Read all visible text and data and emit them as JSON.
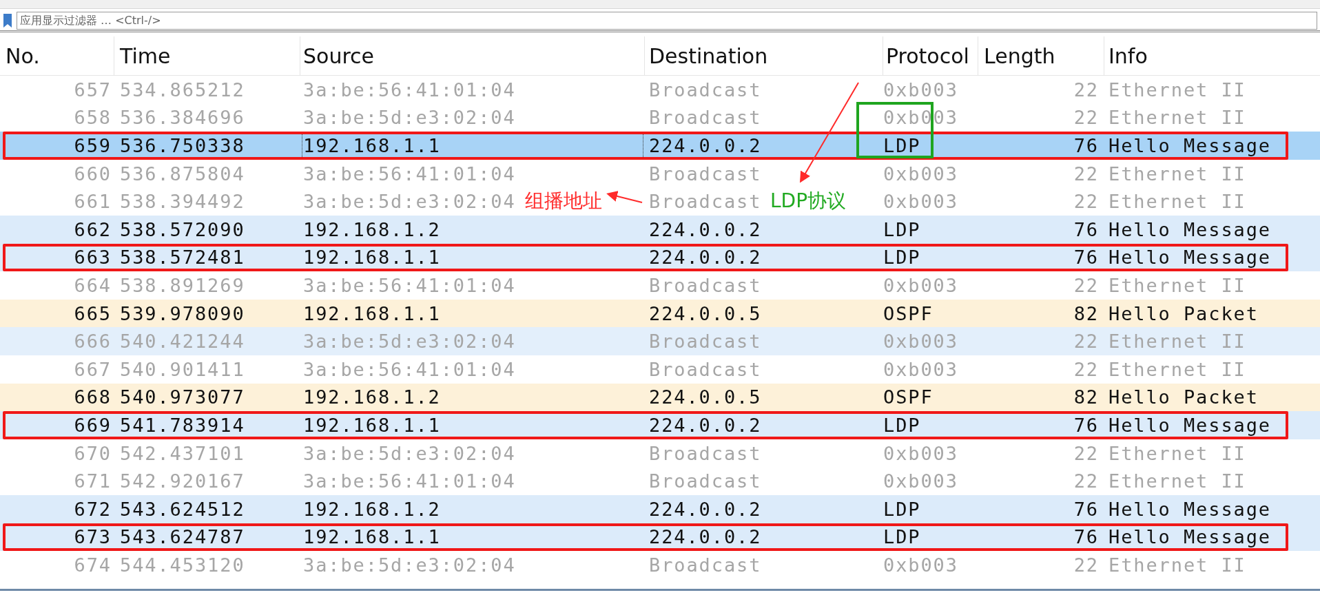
{
  "filter_bar": {
    "placeholder": "应用显示过滤器 … <Ctrl-/>"
  },
  "table": {
    "columns": [
      "No.",
      "Time",
      "Source",
      "Destination",
      "Protocol",
      "Length",
      "Info"
    ],
    "rows": [
      {
        "cells": [
          "657",
          "534.865212",
          "3a:be:56:41:01:04",
          "Broadcast",
          "0xb003",
          "22",
          "Ethernet II"
        ],
        "kind": "other",
        "selected": false,
        "boxed": false
      },
      {
        "cells": [
          "658",
          "536.384696",
          "3a:be:5d:e3:02:04",
          "Broadcast",
          "0xb003",
          "22",
          "Ethernet II"
        ],
        "kind": "other",
        "selected": false,
        "boxed": false
      },
      {
        "cells": [
          "659",
          "536.750338",
          "192.168.1.1",
          "224.0.0.2",
          "LDP",
          "76",
          "Hello Message"
        ],
        "kind": "ldp",
        "selected": true,
        "boxed": true
      },
      {
        "cells": [
          "660",
          "536.875804",
          "3a:be:56:41:01:04",
          "Broadcast",
          "0xb003",
          "22",
          "Ethernet II"
        ],
        "kind": "other",
        "selected": false,
        "boxed": false
      },
      {
        "cells": [
          "661",
          "538.394492",
          "3a:be:5d:e3:02:04",
          "Broadcast",
          "0xb003",
          "22",
          "Ethernet II"
        ],
        "kind": "other",
        "selected": false,
        "boxed": false,
        "annotations": [
          {
            "kind": "label",
            "text": "组播地址",
            "color": "#ff2a2a"
          },
          {
            "kind": "label",
            "text": "LDP协议",
            "color": "#22aa22"
          }
        ]
      },
      {
        "cells": [
          "662",
          "538.572090",
          "192.168.1.2",
          "224.0.0.2",
          "LDP",
          "76",
          "Hello Message"
        ],
        "kind": "ldp",
        "selected": false,
        "boxed": false
      },
      {
        "cells": [
          "663",
          "538.572481",
          "192.168.1.1",
          "224.0.0.2",
          "LDP",
          "76",
          "Hello Message"
        ],
        "kind": "ldp",
        "selected": false,
        "boxed": true
      },
      {
        "cells": [
          "664",
          "538.891269",
          "3a:be:56:41:01:04",
          "Broadcast",
          "0xb003",
          "22",
          "Ethernet II"
        ],
        "kind": "other",
        "selected": false,
        "boxed": false
      },
      {
        "cells": [
          "665",
          "539.978090",
          "192.168.1.1",
          "224.0.0.5",
          "OSPF",
          "82",
          "Hello Packet"
        ],
        "kind": "ospf",
        "selected": false,
        "boxed": false
      },
      {
        "cells": [
          "666",
          "540.421244",
          "3a:be:5d:e3:02:04",
          "Broadcast",
          "0xb003",
          "22",
          "Ethernet II"
        ],
        "kind": "shaded",
        "selected": false,
        "boxed": false
      },
      {
        "cells": [
          "667",
          "540.901411",
          "3a:be:56:41:01:04",
          "Broadcast",
          "0xb003",
          "22",
          "Ethernet II"
        ],
        "kind": "other",
        "selected": false,
        "boxed": false
      },
      {
        "cells": [
          "668",
          "540.973077",
          "192.168.1.2",
          "224.0.0.5",
          "OSPF",
          "82",
          "Hello Packet"
        ],
        "kind": "ospf",
        "selected": false,
        "boxed": false
      },
      {
        "cells": [
          "669",
          "541.783914",
          "192.168.1.1",
          "224.0.0.2",
          "LDP",
          "76",
          "Hello Message"
        ],
        "kind": "ldp",
        "selected": false,
        "boxed": true
      },
      {
        "cells": [
          "670",
          "542.437101",
          "3a:be:5d:e3:02:04",
          "Broadcast",
          "0xb003",
          "22",
          "Ethernet II"
        ],
        "kind": "other",
        "selected": false,
        "boxed": false
      },
      {
        "cells": [
          "671",
          "542.920167",
          "3a:be:56:41:01:04",
          "Broadcast",
          "0xb003",
          "22",
          "Ethernet II"
        ],
        "kind": "other",
        "selected": false,
        "boxed": false
      },
      {
        "cells": [
          "672",
          "543.624512",
          "192.168.1.2",
          "224.0.0.2",
          "LDP",
          "76",
          "Hello Message"
        ],
        "kind": "ldp",
        "selected": false,
        "boxed": false
      },
      {
        "cells": [
          "673",
          "543.624787",
          "192.168.1.1",
          "224.0.0.2",
          "LDP",
          "76",
          "Hello Message"
        ],
        "kind": "ldp",
        "selected": false,
        "boxed": true
      },
      {
        "cells": [
          "674",
          "544.453120",
          "3a:be:5d:e3:02:04",
          "Broadcast",
          "0xb003",
          "22",
          "Ethernet II"
        ],
        "kind": "other",
        "selected": false,
        "boxed": false
      }
    ]
  }
}
